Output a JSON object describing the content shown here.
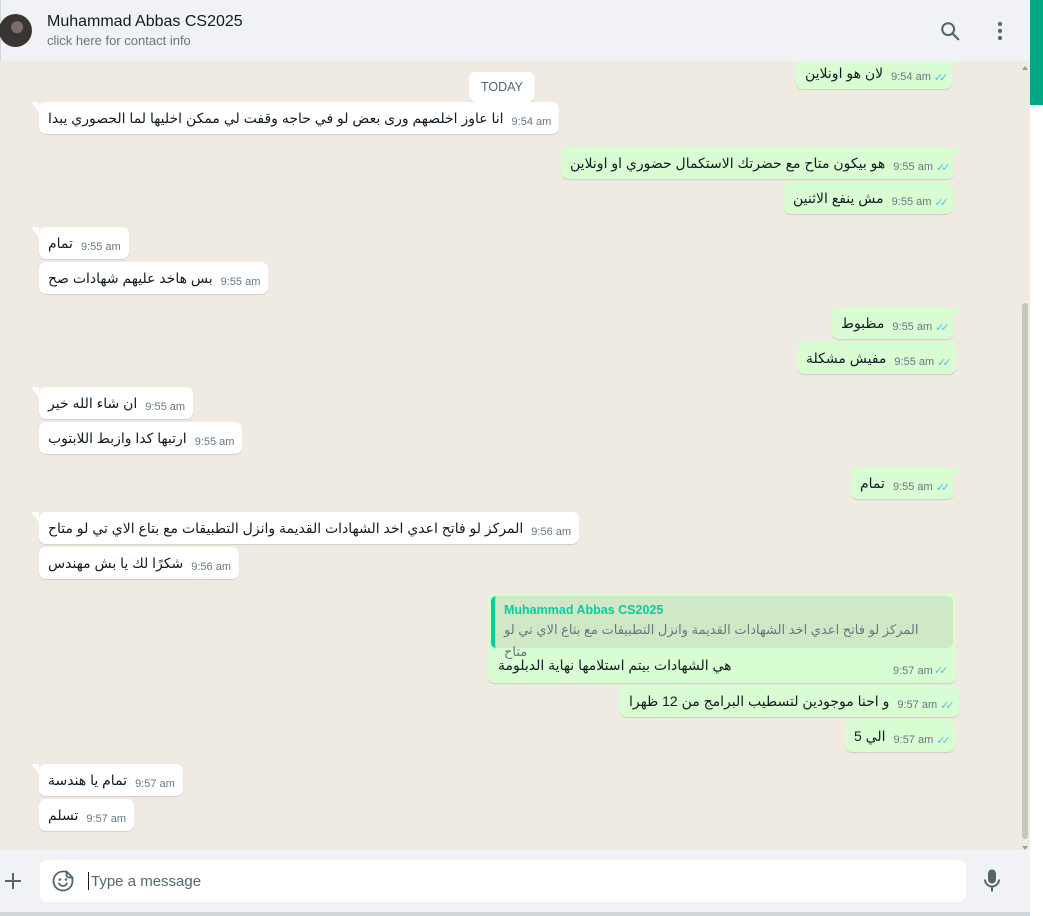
{
  "header": {
    "contact_name": "Muhammad Abbas CS2025",
    "contact_sub": "click here for contact info",
    "search_icon": "search-icon",
    "menu_icon": "kebab-menu-icon"
  },
  "chat": {
    "day_separator": "TODAY",
    "messages": [
      {
        "dir": "out",
        "text": "لان هو اونلاين",
        "time": "9:54 am",
        "status": "read"
      },
      {
        "dir": "in",
        "text": "انا عاوز اخلصهم ورى بعض لو في حاجه وقفت لي ممكن اخليها لما الحصوري يبدا",
        "time": "9:54 am"
      },
      {
        "dir": "out",
        "text": "هو بيكون متاح مع حضرتك الاستكمال حضوري او اونلاين",
        "time": "9:55 am",
        "status": "read"
      },
      {
        "dir": "out",
        "text": "مش ينفع الاثنين",
        "time": "9:55 am",
        "status": "read"
      },
      {
        "dir": "in",
        "text": "تمام",
        "time": "9:55 am"
      },
      {
        "dir": "in",
        "text": "بس هاخد عليهم شهادات صح",
        "time": "9:55 am"
      },
      {
        "dir": "out",
        "text": "مظبوط",
        "time": "9:55 am",
        "status": "read"
      },
      {
        "dir": "out",
        "text": "مفيش مشكلة",
        "time": "9:55 am",
        "status": "read"
      },
      {
        "dir": "in",
        "text": "ان شاء الله خير",
        "time": "9:55 am"
      },
      {
        "dir": "in",
        "text": "ارتبها كدا وازبط اللابتوب",
        "time": "9:55 am"
      },
      {
        "dir": "out",
        "text": "تمام",
        "time": "9:55 am",
        "status": "read"
      },
      {
        "dir": "in",
        "text": "المركز لو فاتح اعدي اخد الشهادات القديمة وانزل التطبيقات مع بتاع الاي تي لو متاح",
        "time": "9:56 am"
      },
      {
        "dir": "in",
        "text": "شكرًا لك يا بش مهندس",
        "time": "9:56 am"
      },
      {
        "dir": "out",
        "text": "و احنا موجودين لتسطيب البرامج من 12 ظهرا",
        "time": "9:57 am",
        "status": "read"
      },
      {
        "dir": "out",
        "text": "الي 5",
        "time": "9:57 am",
        "status": "read"
      },
      {
        "dir": "in",
        "text": "تمام يا هندسة",
        "time": "9:57 am"
      },
      {
        "dir": "in",
        "text": "تسلم",
        "time": "9:57 am"
      }
    ],
    "reply_message": {
      "quoted_name": "Muhammad Abbas CS2025",
      "quoted_text": "المركز لو فاتح اعدي اخد الشهادات القديمة وانزل التطبيقات مع بتاع الاي تي لو متاح",
      "text": "هي الشهادات بيتم استلامها نهاية الدبلومة",
      "time": "9:57 am",
      "status": "read"
    }
  },
  "footer": {
    "attach_icon": "plus-icon",
    "emoji_icon": "emoji-icon",
    "placeholder": "Type a message",
    "mic_icon": "mic-icon"
  },
  "colors": {
    "incoming_bubble": "#ffffff",
    "outgoing_bubble": "#d9fdd3",
    "read_ticks": "#53bdeb",
    "accent": "#00a884",
    "chat_bg": "#efeae2",
    "panel_bg": "#f0f2f5"
  }
}
